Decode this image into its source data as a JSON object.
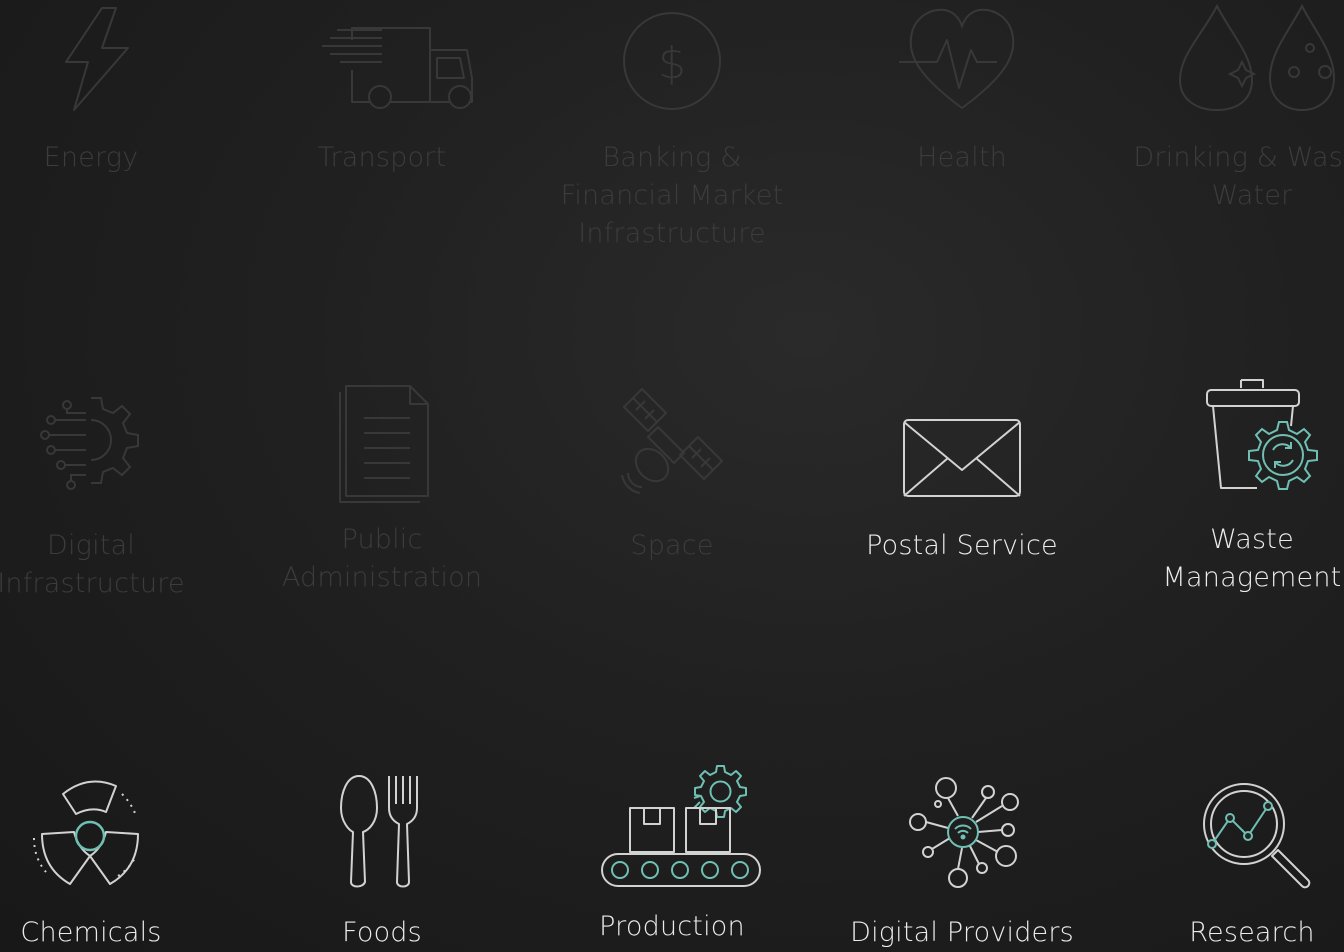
{
  "colors": {
    "dim": "#3c3c3c",
    "lit": "#e6e6e6",
    "accent": "#6fbfb3"
  },
  "sectors": [
    {
      "label": "Energy",
      "icon": "lightning-bolt-icon",
      "active": false
    },
    {
      "label": "Transport",
      "icon": "delivery-truck-icon",
      "active": false
    },
    {
      "label": "Banking & Financial Market Infrastructure",
      "icon": "dollar-coin-icon",
      "active": false
    },
    {
      "label": "Health",
      "icon": "heartbeat-icon",
      "active": false
    },
    {
      "label": "Drinking & Waste Water",
      "icon": "water-drops-icon",
      "active": false
    },
    {
      "label": "Digital Infrastructure",
      "icon": "circuit-gear-icon",
      "active": false
    },
    {
      "label": "Public Administration",
      "icon": "document-icon",
      "active": false
    },
    {
      "label": "Space",
      "icon": "satellite-icon",
      "active": false
    },
    {
      "label": "Postal Service",
      "icon": "envelope-icon",
      "active": true
    },
    {
      "label": "Waste Management",
      "icon": "recycling-bin-icon",
      "active": true
    },
    {
      "label": "Chemicals",
      "icon": "radiation-icon",
      "active": true
    },
    {
      "label": "Foods",
      "icon": "spoon-fork-icon",
      "active": true
    },
    {
      "label": "Production",
      "icon": "conveyor-belt-icon",
      "active": true
    },
    {
      "label": "Digital Providers",
      "icon": "network-hub-icon",
      "active": true
    },
    {
      "label": "Research",
      "icon": "magnifier-chart-icon",
      "active": true
    }
  ]
}
